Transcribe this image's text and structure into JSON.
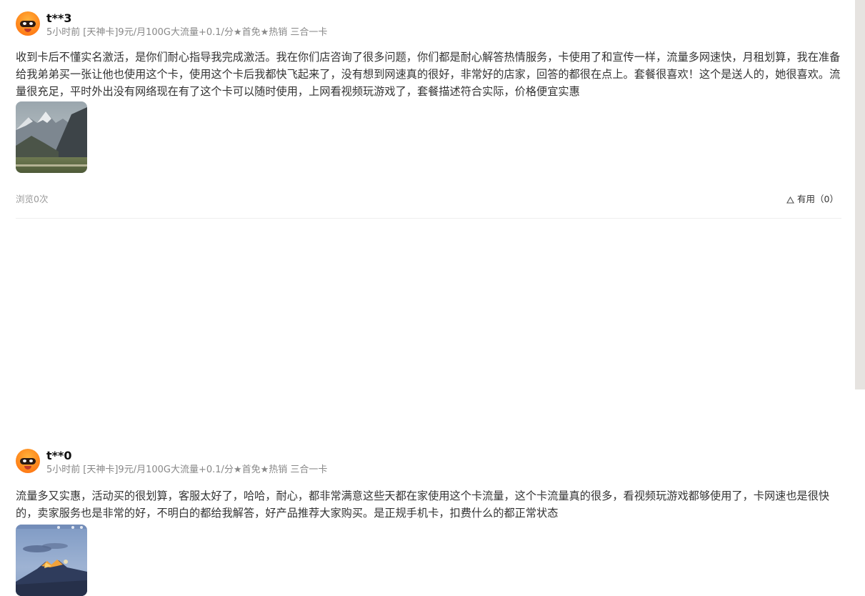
{
  "reviews": [
    {
      "nickname": "t**3",
      "time": "5小时前",
      "spec": "[天神卡]9元/月100G大流量+0.1/分★首免★热销 三合一卡",
      "content": "收到卡后不懂实名激活，是你们耐心指导我完成激活。我在你们店咨询了很多问题，你们都是耐心解答热情服务，卡使用了和宣传一样，流量多网速快，月租划算，我在准备给我弟弟买一张让他也使用这个卡，使用这个卡后我都快飞起来了，没有想到网速真的很好，非常好的店家，回答的都很在点上。套餐很喜欢！这个是送人的，她很喜欢。流量很充足，平时外出没有网络现在有了这个卡可以随时使用，上网看视频玩游戏了，套餐描述符合实际，价格便宜实惠",
      "photo": "mountain-landscape",
      "views_label": "浏览0次",
      "useful_label": "有用（0）"
    },
    {
      "nickname": "t**0",
      "time": "5小时前",
      "spec": "[天神卡]9元/月100G大流量+0.1/分★首免★热销 三合一卡",
      "content": "流量多又实惠，活动买的很划算，客服太好了，哈哈，耐心，都非常满意这些天都在家使用这个卡流量，这个卡流量真的很多，看视频玩游戏都够使用了，卡网速也是很快的，卖家服务也是非常的好，不明白的都给我解答，好产品推荐大家购买。是正规手机卡，扣费什么的都正常状态",
      "photo": "sunset-mountain-phone-screenshot"
    }
  ]
}
